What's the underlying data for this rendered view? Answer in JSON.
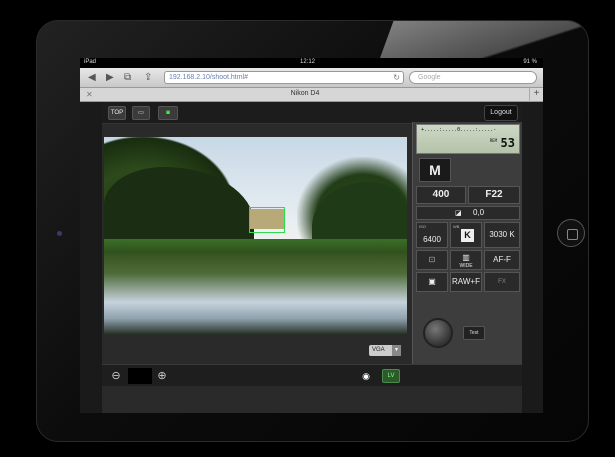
{
  "device": {
    "status": {
      "carrier": "iPad",
      "time": "12:12",
      "battery": "91 %"
    }
  },
  "browser": {
    "url": "192.168.2.10/shoot.html#",
    "search_placeholder": "Google",
    "tab_title": "Nikon D4"
  },
  "toolbar": {
    "top_label": "TOP",
    "logout_label": "Logout"
  },
  "liveview": {
    "resolution": "VGA"
  },
  "camera": {
    "meter_scale": "+.....:.....0.....:.....-",
    "rem_label": "REM",
    "shots_remaining": "53",
    "mode": "M",
    "shutter_speed": "400",
    "aperture": "F22",
    "exposure_comp": "0,0",
    "iso_label": "ISO",
    "iso": "6400",
    "wb_label": "WB",
    "wb_mode": "K",
    "wb_kelvin": "3030 K",
    "wide_label": "WIDE",
    "focus_mode": "AF-F",
    "image_quality": "RAW+F",
    "fx_label": "FX",
    "test_label": "Test"
  },
  "colors": {
    "af_frame": "#32d94a",
    "lv_accent": "#2b5a2b"
  }
}
